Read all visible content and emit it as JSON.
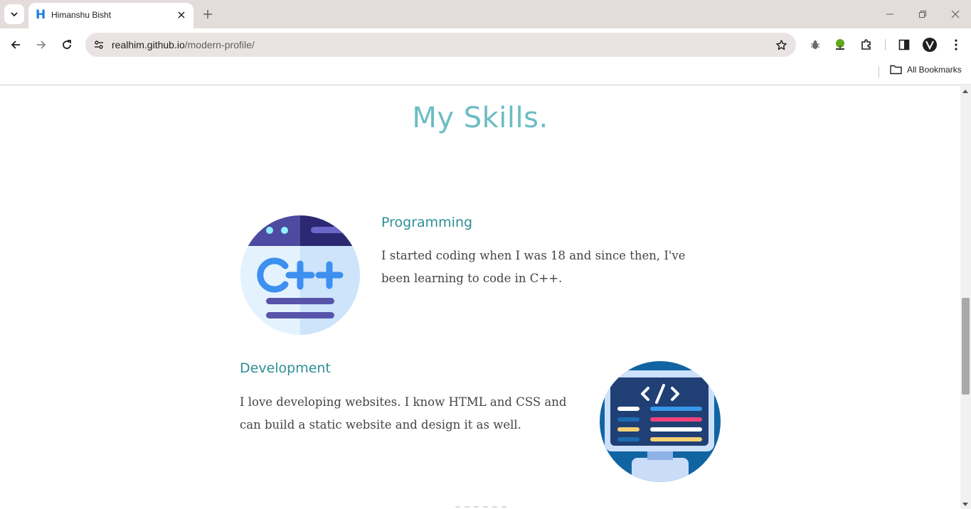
{
  "browser": {
    "tab": {
      "title": "Himanshu Bisht",
      "favicon": "H"
    },
    "url": {
      "host": "realhim.github.io",
      "path": "/modern-profile/"
    },
    "bookmarks": {
      "all_label": "All Bookmarks"
    }
  },
  "page": {
    "heading": "My Skills.",
    "skills": [
      {
        "title": "Programming",
        "text": "I started coding when I was 18 and since then, I've been learning to code in C++.",
        "icon": "cpp-code-icon",
        "icon_text": "C++"
      },
      {
        "title": "Development",
        "text": "I love developing websites. I know HTML and CSS and can build a static website and design it as well.",
        "icon": "web-development-monitor-icon",
        "icon_text": "</>"
      }
    ]
  },
  "colors": {
    "heading": "#6cbcc4",
    "skill_title": "#2f8f96",
    "body_text": "#444444",
    "tab_strip": "#e4dcdb"
  }
}
